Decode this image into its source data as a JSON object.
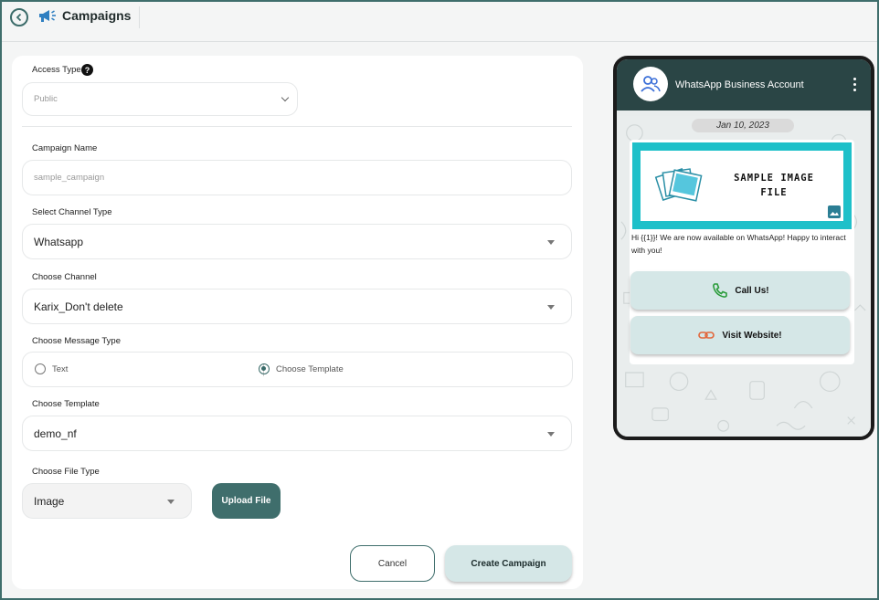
{
  "header": {
    "title": "Campaigns",
    "back_icon": "back-arrow-circle-icon",
    "page_icon": "megaphone-icon"
  },
  "form": {
    "access_type": {
      "label": "Access Type",
      "help": "?",
      "value": "Public"
    },
    "campaign_name": {
      "label": "Campaign Name",
      "placeholder": "sample_campaign"
    },
    "channel_type": {
      "label": "Select Channel Type",
      "value": "Whatsapp"
    },
    "channel": {
      "label": "Choose Channel",
      "value": "Karix_Don't delete"
    },
    "message_type": {
      "label": "Choose Message Type",
      "options": [
        {
          "label": "Text",
          "selected": false
        },
        {
          "label": "Choose Template",
          "selected": true
        }
      ]
    },
    "template": {
      "label": "Choose Template",
      "value": "demo_nf"
    },
    "file_type": {
      "label": "Choose File Type",
      "value": "Image"
    },
    "upload_label": "Upload File",
    "cancel_label": "Cancel",
    "create_label": "Create Campaign"
  },
  "preview": {
    "account_name": "WhatsApp Business Account",
    "date": "Jan 10, 2023",
    "image_text_line1": "SAMPLE IMAGE",
    "image_text_line2": "FILE",
    "message": "Hi {{1}}! We are now available on WhatsApp! Happy to interact with you!",
    "buttons": [
      {
        "label": "Call Us!",
        "icon": "phone-icon"
      },
      {
        "label": "Visit Website!",
        "icon": "link-icon"
      }
    ]
  },
  "colors": {
    "primary": "#3f6e6c",
    "wa_header": "#2a4545",
    "image_border": "#1ec0c9",
    "button_light": "#d5e7e7"
  }
}
